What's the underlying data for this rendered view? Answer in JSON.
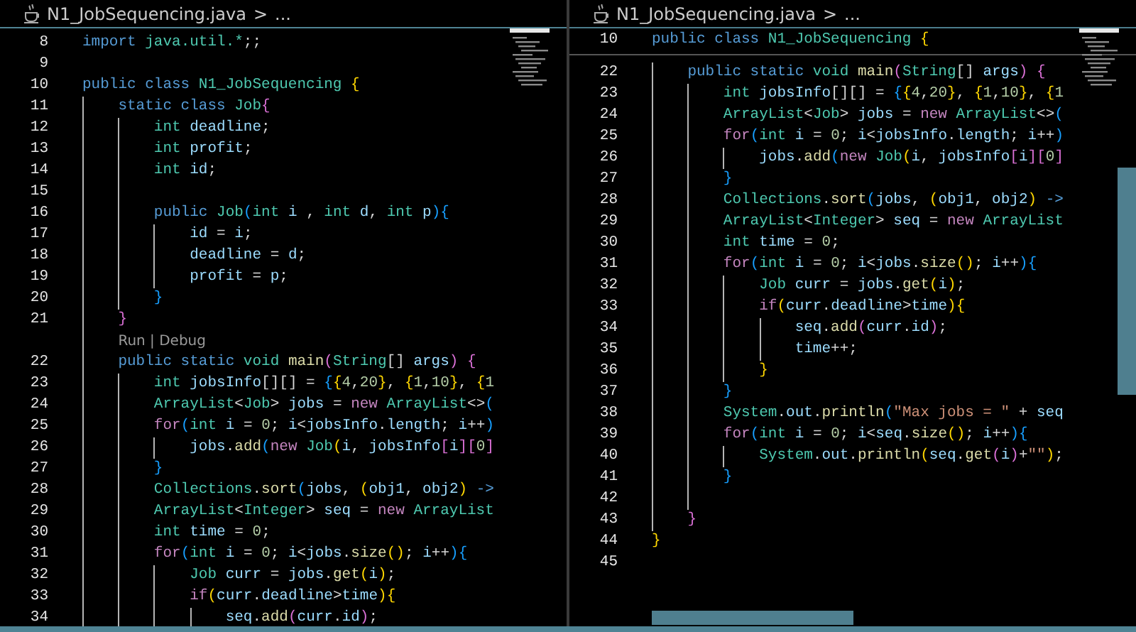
{
  "panes": [
    {
      "breadcrumb": {
        "file": "N1_JobSequencing.java",
        "separator": ">",
        "rest": "..."
      },
      "lines": [
        {
          "kind": "code",
          "number": "8",
          "tokens": [
            {
              "text": "import ",
              "kind": "kw"
            },
            {
              "text": "java.util.*",
              "kind": "ty"
            },
            {
              "text": ";;",
              "kind": "op"
            }
          ]
        },
        {
          "kind": "code",
          "number": "9"
        },
        {
          "kind": "code",
          "number": "10",
          "tokens": [
            {
              "text": "public class ",
              "kind": "kw"
            },
            {
              "text": "N1_JobSequencing ",
              "kind": "ty"
            },
            {
              "text": "{",
              "kind": "b1"
            }
          ]
        },
        {
          "kind": "code",
          "number": "11",
          "tokens": [
            {
              "text": "    static class ",
              "kind": "kw"
            },
            {
              "text": "Job",
              "kind": "ty"
            },
            {
              "text": "{",
              "kind": "b2"
            }
          ]
        },
        {
          "kind": "code",
          "number": "12",
          "tokens": [
            {
              "text": "        int ",
              "kind": "ty"
            },
            {
              "text": "deadline",
              "kind": "var"
            },
            {
              "text": ";",
              "kind": "op"
            }
          ]
        },
        {
          "kind": "code",
          "number": "13",
          "tokens": [
            {
              "text": "        int ",
              "kind": "ty"
            },
            {
              "text": "profit",
              "kind": "var"
            },
            {
              "text": ";",
              "kind": "op"
            }
          ]
        },
        {
          "kind": "code",
          "number": "14",
          "tokens": [
            {
              "text": "        int ",
              "kind": "ty"
            },
            {
              "text": "id",
              "kind": "var"
            },
            {
              "text": ";",
              "kind": "op"
            }
          ]
        },
        {
          "kind": "code",
          "number": "15"
        },
        {
          "kind": "code",
          "number": "16",
          "tokens": [
            {
              "text": "        public ",
              "kind": "kw"
            },
            {
              "text": "Job",
              "kind": "ty"
            },
            {
              "text": "(",
              "kind": "b3"
            },
            {
              "text": "int ",
              "kind": "ty"
            },
            {
              "text": "i",
              "kind": "var"
            },
            {
              "text": " , ",
              "kind": "op"
            },
            {
              "text": "int ",
              "kind": "ty"
            },
            {
              "text": "d",
              "kind": "var"
            },
            {
              "text": ", ",
              "kind": "op"
            },
            {
              "text": "int ",
              "kind": "ty"
            },
            {
              "text": "p",
              "kind": "var"
            },
            {
              "text": ")",
              "kind": "b3"
            },
            {
              "text": "{",
              "kind": "b3"
            }
          ]
        },
        {
          "kind": "code",
          "number": "17",
          "tokens": [
            {
              "text": "            id",
              "kind": "var"
            },
            {
              "text": " = ",
              "kind": "op"
            },
            {
              "text": "i",
              "kind": "var"
            },
            {
              "text": ";",
              "kind": "op"
            }
          ]
        },
        {
          "kind": "code",
          "number": "18",
          "tokens": [
            {
              "text": "            deadline",
              "kind": "var"
            },
            {
              "text": " = ",
              "kind": "op"
            },
            {
              "text": "d",
              "kind": "var"
            },
            {
              "text": ";",
              "kind": "op"
            }
          ]
        },
        {
          "kind": "code",
          "number": "19",
          "tokens": [
            {
              "text": "            profit",
              "kind": "var"
            },
            {
              "text": " = ",
              "kind": "op"
            },
            {
              "text": "p",
              "kind": "var"
            },
            {
              "text": ";",
              "kind": "op"
            }
          ]
        },
        {
          "kind": "code",
          "number": "20",
          "tokens": [
            {
              "text": "        }",
              "kind": "b3"
            }
          ]
        },
        {
          "kind": "code",
          "number": "21",
          "tokens": [
            {
              "text": "    }",
              "kind": "b2"
            }
          ]
        },
        {
          "kind": "codelens",
          "text": "Run | Debug"
        },
        {
          "kind": "code",
          "number": "22",
          "tokens": [
            {
              "text": "    public static ",
              "kind": "kw"
            },
            {
              "text": "void ",
              "kind": "ty"
            },
            {
              "text": "main",
              "kind": "fn"
            },
            {
              "text": "(",
              "kind": "b2"
            },
            {
              "text": "String",
              "kind": "ty"
            },
            {
              "text": "[] ",
              "kind": "op"
            },
            {
              "text": "args",
              "kind": "var"
            },
            {
              "text": ")",
              "kind": "b2"
            },
            {
              "text": " {",
              "kind": "b2"
            }
          ]
        },
        {
          "kind": "code",
          "number": "23",
          "tokens": [
            {
              "text": "        int ",
              "kind": "ty"
            },
            {
              "text": "jobsInfo",
              "kind": "var"
            },
            {
              "text": "[][] = ",
              "kind": "op"
            },
            {
              "text": "{",
              "kind": "b3"
            },
            {
              "text": "{",
              "kind": "b1"
            },
            {
              "text": "4",
              "kind": "num"
            },
            {
              "text": ",",
              "kind": "op"
            },
            {
              "text": "20",
              "kind": "num"
            },
            {
              "text": "}",
              "kind": "b1"
            },
            {
              "text": ", ",
              "kind": "op"
            },
            {
              "text": "{",
              "kind": "b1"
            },
            {
              "text": "1",
              "kind": "num"
            },
            {
              "text": ",",
              "kind": "op"
            },
            {
              "text": "10",
              "kind": "num"
            },
            {
              "text": "}",
              "kind": "b1"
            },
            {
              "text": ", ",
              "kind": "op"
            },
            {
              "text": "{",
              "kind": "b1"
            },
            {
              "text": "1",
              "kind": "num"
            }
          ]
        },
        {
          "kind": "code",
          "number": "24",
          "tokens": [
            {
              "text": "        ArrayList",
              "kind": "ty"
            },
            {
              "text": "<",
              "kind": "op"
            },
            {
              "text": "Job",
              "kind": "ty"
            },
            {
              "text": "> ",
              "kind": "op"
            },
            {
              "text": "jobs",
              "kind": "var"
            },
            {
              "text": " = ",
              "kind": "op"
            },
            {
              "text": "new ",
              "kind": "ctl"
            },
            {
              "text": "ArrayList",
              "kind": "ty"
            },
            {
              "text": "<>",
              "kind": "op"
            },
            {
              "text": "(",
              "kind": "b3"
            }
          ]
        },
        {
          "kind": "code",
          "number": "25",
          "tokens": [
            {
              "text": "        for",
              "kind": "ctl"
            },
            {
              "text": "(",
              "kind": "b3"
            },
            {
              "text": "int ",
              "kind": "ty"
            },
            {
              "text": "i",
              "kind": "var"
            },
            {
              "text": " = ",
              "kind": "op"
            },
            {
              "text": "0",
              "kind": "num"
            },
            {
              "text": "; ",
              "kind": "op"
            },
            {
              "text": "i",
              "kind": "var"
            },
            {
              "text": "<",
              "kind": "op"
            },
            {
              "text": "jobsInfo",
              "kind": "var"
            },
            {
              "text": ".",
              "kind": "op"
            },
            {
              "text": "length",
              "kind": "var"
            },
            {
              "text": "; ",
              "kind": "op"
            },
            {
              "text": "i",
              "kind": "var"
            },
            {
              "text": "++",
              "kind": "op"
            },
            {
              "text": ")",
              "kind": "b3"
            }
          ]
        },
        {
          "kind": "code",
          "number": "26",
          "tokens": [
            {
              "text": "            jobs",
              "kind": "var"
            },
            {
              "text": ".",
              "kind": "op"
            },
            {
              "text": "add",
              "kind": "fn"
            },
            {
              "text": "(",
              "kind": "b3"
            },
            {
              "text": "new ",
              "kind": "ctl"
            },
            {
              "text": "Job",
              "kind": "ty"
            },
            {
              "text": "(",
              "kind": "b1"
            },
            {
              "text": "i",
              "kind": "var"
            },
            {
              "text": ", ",
              "kind": "op"
            },
            {
              "text": "jobsInfo",
              "kind": "var"
            },
            {
              "text": "[",
              "kind": "b2"
            },
            {
              "text": "i",
              "kind": "var"
            },
            {
              "text": "]",
              "kind": "b2"
            },
            {
              "text": "[",
              "kind": "b2"
            },
            {
              "text": "0",
              "kind": "num"
            },
            {
              "text": "]",
              "kind": "b2"
            }
          ]
        },
        {
          "kind": "code",
          "number": "27",
          "tokens": [
            {
              "text": "        }",
              "kind": "b3"
            }
          ]
        },
        {
          "kind": "code",
          "number": "28",
          "tokens": [
            {
              "text": "        Collections",
              "kind": "ty"
            },
            {
              "text": ".",
              "kind": "op"
            },
            {
              "text": "sort",
              "kind": "fn"
            },
            {
              "text": "(",
              "kind": "b3"
            },
            {
              "text": "jobs",
              "kind": "var"
            },
            {
              "text": ", ",
              "kind": "op"
            },
            {
              "text": "(",
              "kind": "b1"
            },
            {
              "text": "obj1",
              "kind": "var"
            },
            {
              "text": ", ",
              "kind": "op"
            },
            {
              "text": "obj2",
              "kind": "var"
            },
            {
              "text": ")",
              "kind": "b1"
            },
            {
              "text": " ->",
              "kind": "kw"
            }
          ]
        },
        {
          "kind": "code",
          "number": "29",
          "tokens": [
            {
              "text": "        ArrayList",
              "kind": "ty"
            },
            {
              "text": "<",
              "kind": "op"
            },
            {
              "text": "Integer",
              "kind": "ty"
            },
            {
              "text": "> ",
              "kind": "op"
            },
            {
              "text": "seq",
              "kind": "var"
            },
            {
              "text": " = ",
              "kind": "op"
            },
            {
              "text": "new ",
              "kind": "ctl"
            },
            {
              "text": "ArrayList",
              "kind": "ty"
            }
          ]
        },
        {
          "kind": "code",
          "number": "30",
          "tokens": [
            {
              "text": "        int ",
              "kind": "ty"
            },
            {
              "text": "time",
              "kind": "var"
            },
            {
              "text": " = ",
              "kind": "op"
            },
            {
              "text": "0",
              "kind": "num"
            },
            {
              "text": ";",
              "kind": "op"
            }
          ]
        },
        {
          "kind": "code",
          "number": "31",
          "tokens": [
            {
              "text": "        for",
              "kind": "ctl"
            },
            {
              "text": "(",
              "kind": "b3"
            },
            {
              "text": "int ",
              "kind": "ty"
            },
            {
              "text": "i",
              "kind": "var"
            },
            {
              "text": " = ",
              "kind": "op"
            },
            {
              "text": "0",
              "kind": "num"
            },
            {
              "text": "; ",
              "kind": "op"
            },
            {
              "text": "i",
              "kind": "var"
            },
            {
              "text": "<",
              "kind": "op"
            },
            {
              "text": "jobs",
              "kind": "var"
            },
            {
              "text": ".",
              "kind": "op"
            },
            {
              "text": "size",
              "kind": "fn"
            },
            {
              "text": "()",
              "kind": "b1"
            },
            {
              "text": "; ",
              "kind": "op"
            },
            {
              "text": "i",
              "kind": "var"
            },
            {
              "text": "++",
              "kind": "op"
            },
            {
              "text": ")",
              "kind": "b3"
            },
            {
              "text": "{",
              "kind": "b3"
            }
          ]
        },
        {
          "kind": "code",
          "number": "32",
          "tokens": [
            {
              "text": "            Job ",
              "kind": "ty"
            },
            {
              "text": "curr",
              "kind": "var"
            },
            {
              "text": " = ",
              "kind": "op"
            },
            {
              "text": "jobs",
              "kind": "var"
            },
            {
              "text": ".",
              "kind": "op"
            },
            {
              "text": "get",
              "kind": "fn"
            },
            {
              "text": "(",
              "kind": "b1"
            },
            {
              "text": "i",
              "kind": "var"
            },
            {
              "text": ")",
              "kind": "b1"
            },
            {
              "text": ";",
              "kind": "op"
            }
          ]
        },
        {
          "kind": "code",
          "number": "33",
          "tokens": [
            {
              "text": "            if",
              "kind": "ctl"
            },
            {
              "text": "(",
              "kind": "b1"
            },
            {
              "text": "curr",
              "kind": "var"
            },
            {
              "text": ".",
              "kind": "op"
            },
            {
              "text": "deadline",
              "kind": "var"
            },
            {
              "text": ">",
              "kind": "op"
            },
            {
              "text": "time",
              "kind": "var"
            },
            {
              "text": ")",
              "kind": "b1"
            },
            {
              "text": "{",
              "kind": "b1"
            }
          ]
        },
        {
          "kind": "code",
          "number": "34",
          "tokens": [
            {
              "text": "                seq",
              "kind": "var"
            },
            {
              "text": ".",
              "kind": "op"
            },
            {
              "text": "add",
              "kind": "fn"
            },
            {
              "text": "(",
              "kind": "b2"
            },
            {
              "text": "curr",
              "kind": "var"
            },
            {
              "text": ".",
              "kind": "op"
            },
            {
              "text": "id",
              "kind": "var"
            },
            {
              "text": ")",
              "kind": "b2"
            },
            {
              "text": ";",
              "kind": "op"
            }
          ]
        }
      ]
    },
    {
      "breadcrumb": {
        "file": "N1_JobSequencing.java",
        "separator": ">",
        "rest": "..."
      },
      "sticky": {
        "kind": "code",
        "number": "10",
        "tokens": [
          {
            "text": "public class ",
            "kind": "kw"
          },
          {
            "text": "N1_JobSequencing ",
            "kind": "ty"
          },
          {
            "text": "{",
            "kind": "b1"
          }
        ]
      },
      "scrollbars": true,
      "lines": [
        {
          "kind": "code",
          "number": "22",
          "tokens": [
            {
              "text": "    public static ",
              "kind": "kw"
            },
            {
              "text": "void ",
              "kind": "ty"
            },
            {
              "text": "main",
              "kind": "fn"
            },
            {
              "text": "(",
              "kind": "b2"
            },
            {
              "text": "String",
              "kind": "ty"
            },
            {
              "text": "[] ",
              "kind": "op"
            },
            {
              "text": "args",
              "kind": "var"
            },
            {
              "text": ")",
              "kind": "b2"
            },
            {
              "text": " {",
              "kind": "b2"
            }
          ]
        },
        {
          "kind": "code",
          "number": "23",
          "tokens": [
            {
              "text": "        int ",
              "kind": "ty"
            },
            {
              "text": "jobsInfo",
              "kind": "var"
            },
            {
              "text": "[][] = ",
              "kind": "op"
            },
            {
              "text": "{",
              "kind": "b3"
            },
            {
              "text": "{",
              "kind": "b1"
            },
            {
              "text": "4",
              "kind": "num"
            },
            {
              "text": ",",
              "kind": "op"
            },
            {
              "text": "20",
              "kind": "num"
            },
            {
              "text": "}",
              "kind": "b1"
            },
            {
              "text": ", ",
              "kind": "op"
            },
            {
              "text": "{",
              "kind": "b1"
            },
            {
              "text": "1",
              "kind": "num"
            },
            {
              "text": ",",
              "kind": "op"
            },
            {
              "text": "10",
              "kind": "num"
            },
            {
              "text": "}",
              "kind": "b1"
            },
            {
              "text": ", ",
              "kind": "op"
            },
            {
              "text": "{",
              "kind": "b1"
            },
            {
              "text": "1",
              "kind": "num"
            }
          ]
        },
        {
          "kind": "code",
          "number": "24",
          "tokens": [
            {
              "text": "        ArrayList",
              "kind": "ty"
            },
            {
              "text": "<",
              "kind": "op"
            },
            {
              "text": "Job",
              "kind": "ty"
            },
            {
              "text": "> ",
              "kind": "op"
            },
            {
              "text": "jobs",
              "kind": "var"
            },
            {
              "text": " = ",
              "kind": "op"
            },
            {
              "text": "new ",
              "kind": "ctl"
            },
            {
              "text": "ArrayList",
              "kind": "ty"
            },
            {
              "text": "<>",
              "kind": "op"
            },
            {
              "text": "(",
              "kind": "b3"
            }
          ]
        },
        {
          "kind": "code",
          "number": "25",
          "tokens": [
            {
              "text": "        for",
              "kind": "ctl"
            },
            {
              "text": "(",
              "kind": "b3"
            },
            {
              "text": "int ",
              "kind": "ty"
            },
            {
              "text": "i",
              "kind": "var"
            },
            {
              "text": " = ",
              "kind": "op"
            },
            {
              "text": "0",
              "kind": "num"
            },
            {
              "text": "; ",
              "kind": "op"
            },
            {
              "text": "i",
              "kind": "var"
            },
            {
              "text": "<",
              "kind": "op"
            },
            {
              "text": "jobsInfo",
              "kind": "var"
            },
            {
              "text": ".",
              "kind": "op"
            },
            {
              "text": "length",
              "kind": "var"
            },
            {
              "text": "; ",
              "kind": "op"
            },
            {
              "text": "i",
              "kind": "var"
            },
            {
              "text": "++",
              "kind": "op"
            },
            {
              "text": ")",
              "kind": "b3"
            }
          ]
        },
        {
          "kind": "code",
          "number": "26",
          "tokens": [
            {
              "text": "            jobs",
              "kind": "var"
            },
            {
              "text": ".",
              "kind": "op"
            },
            {
              "text": "add",
              "kind": "fn"
            },
            {
              "text": "(",
              "kind": "b3"
            },
            {
              "text": "new ",
              "kind": "ctl"
            },
            {
              "text": "Job",
              "kind": "ty"
            },
            {
              "text": "(",
              "kind": "b1"
            },
            {
              "text": "i",
              "kind": "var"
            },
            {
              "text": ", ",
              "kind": "op"
            },
            {
              "text": "jobsInfo",
              "kind": "var"
            },
            {
              "text": "[",
              "kind": "b2"
            },
            {
              "text": "i",
              "kind": "var"
            },
            {
              "text": "]",
              "kind": "b2"
            },
            {
              "text": "[",
              "kind": "b2"
            },
            {
              "text": "0",
              "kind": "num"
            },
            {
              "text": "]",
              "kind": "b2"
            }
          ]
        },
        {
          "kind": "code",
          "number": "27",
          "tokens": [
            {
              "text": "        }",
              "kind": "b3"
            }
          ]
        },
        {
          "kind": "code",
          "number": "28",
          "tokens": [
            {
              "text": "        Collections",
              "kind": "ty"
            },
            {
              "text": ".",
              "kind": "op"
            },
            {
              "text": "sort",
              "kind": "fn"
            },
            {
              "text": "(",
              "kind": "b3"
            },
            {
              "text": "jobs",
              "kind": "var"
            },
            {
              "text": ", ",
              "kind": "op"
            },
            {
              "text": "(",
              "kind": "b1"
            },
            {
              "text": "obj1",
              "kind": "var"
            },
            {
              "text": ", ",
              "kind": "op"
            },
            {
              "text": "obj2",
              "kind": "var"
            },
            {
              "text": ")",
              "kind": "b1"
            },
            {
              "text": " ->",
              "kind": "kw"
            }
          ]
        },
        {
          "kind": "code",
          "number": "29",
          "tokens": [
            {
              "text": "        ArrayList",
              "kind": "ty"
            },
            {
              "text": "<",
              "kind": "op"
            },
            {
              "text": "Integer",
              "kind": "ty"
            },
            {
              "text": "> ",
              "kind": "op"
            },
            {
              "text": "seq",
              "kind": "var"
            },
            {
              "text": " = ",
              "kind": "op"
            },
            {
              "text": "new ",
              "kind": "ctl"
            },
            {
              "text": "ArrayList",
              "kind": "ty"
            }
          ]
        },
        {
          "kind": "code",
          "number": "30",
          "tokens": [
            {
              "text": "        int ",
              "kind": "ty"
            },
            {
              "text": "time",
              "kind": "var"
            },
            {
              "text": " = ",
              "kind": "op"
            },
            {
              "text": "0",
              "kind": "num"
            },
            {
              "text": ";",
              "kind": "op"
            }
          ]
        },
        {
          "kind": "code",
          "number": "31",
          "tokens": [
            {
              "text": "        for",
              "kind": "ctl"
            },
            {
              "text": "(",
              "kind": "b3"
            },
            {
              "text": "int ",
              "kind": "ty"
            },
            {
              "text": "i",
              "kind": "var"
            },
            {
              "text": " = ",
              "kind": "op"
            },
            {
              "text": "0",
              "kind": "num"
            },
            {
              "text": "; ",
              "kind": "op"
            },
            {
              "text": "i",
              "kind": "var"
            },
            {
              "text": "<",
              "kind": "op"
            },
            {
              "text": "jobs",
              "kind": "var"
            },
            {
              "text": ".",
              "kind": "op"
            },
            {
              "text": "size",
              "kind": "fn"
            },
            {
              "text": "()",
              "kind": "b1"
            },
            {
              "text": "; ",
              "kind": "op"
            },
            {
              "text": "i",
              "kind": "var"
            },
            {
              "text": "++",
              "kind": "op"
            },
            {
              "text": ")",
              "kind": "b3"
            },
            {
              "text": "{",
              "kind": "b3"
            }
          ]
        },
        {
          "kind": "code",
          "number": "32",
          "tokens": [
            {
              "text": "            Job ",
              "kind": "ty"
            },
            {
              "text": "curr",
              "kind": "var"
            },
            {
              "text": " = ",
              "kind": "op"
            },
            {
              "text": "jobs",
              "kind": "var"
            },
            {
              "text": ".",
              "kind": "op"
            },
            {
              "text": "get",
              "kind": "fn"
            },
            {
              "text": "(",
              "kind": "b1"
            },
            {
              "text": "i",
              "kind": "var"
            },
            {
              "text": ")",
              "kind": "b1"
            },
            {
              "text": ";",
              "kind": "op"
            }
          ]
        },
        {
          "kind": "code",
          "number": "33",
          "tokens": [
            {
              "text": "            if",
              "kind": "ctl"
            },
            {
              "text": "(",
              "kind": "b1"
            },
            {
              "text": "curr",
              "kind": "var"
            },
            {
              "text": ".",
              "kind": "op"
            },
            {
              "text": "deadline",
              "kind": "var"
            },
            {
              "text": ">",
              "kind": "op"
            },
            {
              "text": "time",
              "kind": "var"
            },
            {
              "text": ")",
              "kind": "b1"
            },
            {
              "text": "{",
              "kind": "b1"
            }
          ]
        },
        {
          "kind": "code",
          "number": "34",
          "tokens": [
            {
              "text": "                seq",
              "kind": "var"
            },
            {
              "text": ".",
              "kind": "op"
            },
            {
              "text": "add",
              "kind": "fn"
            },
            {
              "text": "(",
              "kind": "b2"
            },
            {
              "text": "curr",
              "kind": "var"
            },
            {
              "text": ".",
              "kind": "op"
            },
            {
              "text": "id",
              "kind": "var"
            },
            {
              "text": ")",
              "kind": "b2"
            },
            {
              "text": ";",
              "kind": "op"
            }
          ]
        },
        {
          "kind": "code",
          "number": "35",
          "tokens": [
            {
              "text": "                time",
              "kind": "var"
            },
            {
              "text": "++;",
              "kind": "op"
            }
          ]
        },
        {
          "kind": "code",
          "number": "36",
          "tokens": [
            {
              "text": "            }",
              "kind": "b1"
            }
          ]
        },
        {
          "kind": "code",
          "number": "37",
          "tokens": [
            {
              "text": "        }",
              "kind": "b3"
            }
          ]
        },
        {
          "kind": "code",
          "number": "38",
          "tokens": [
            {
              "text": "        System",
              "kind": "ty"
            },
            {
              "text": ".",
              "kind": "op"
            },
            {
              "text": "out",
              "kind": "var"
            },
            {
              "text": ".",
              "kind": "op"
            },
            {
              "text": "println",
              "kind": "fn"
            },
            {
              "text": "(",
              "kind": "b3"
            },
            {
              "text": "\"Max jobs = \"",
              "kind": "str"
            },
            {
              "text": " + ",
              "kind": "op"
            },
            {
              "text": "seq",
              "kind": "var"
            }
          ]
        },
        {
          "kind": "code",
          "number": "39",
          "tokens": [
            {
              "text": "        for",
              "kind": "ctl"
            },
            {
              "text": "(",
              "kind": "b3"
            },
            {
              "text": "int ",
              "kind": "ty"
            },
            {
              "text": "i",
              "kind": "var"
            },
            {
              "text": " = ",
              "kind": "op"
            },
            {
              "text": "0",
              "kind": "num"
            },
            {
              "text": "; ",
              "kind": "op"
            },
            {
              "text": "i",
              "kind": "var"
            },
            {
              "text": "<",
              "kind": "op"
            },
            {
              "text": "seq",
              "kind": "var"
            },
            {
              "text": ".",
              "kind": "op"
            },
            {
              "text": "size",
              "kind": "fn"
            },
            {
              "text": "()",
              "kind": "b1"
            },
            {
              "text": "; ",
              "kind": "op"
            },
            {
              "text": "i",
              "kind": "var"
            },
            {
              "text": "++",
              "kind": "op"
            },
            {
              "text": ")",
              "kind": "b3"
            },
            {
              "text": "{",
              "kind": "b3"
            }
          ]
        },
        {
          "kind": "code",
          "number": "40",
          "tokens": [
            {
              "text": "            System",
              "kind": "ty"
            },
            {
              "text": ".",
              "kind": "op"
            },
            {
              "text": "out",
              "kind": "var"
            },
            {
              "text": ".",
              "kind": "op"
            },
            {
              "text": "println",
              "kind": "fn"
            },
            {
              "text": "(",
              "kind": "b1"
            },
            {
              "text": "seq",
              "kind": "var"
            },
            {
              "text": ".",
              "kind": "op"
            },
            {
              "text": "get",
              "kind": "fn"
            },
            {
              "text": "(",
              "kind": "b2"
            },
            {
              "text": "i",
              "kind": "var"
            },
            {
              "text": ")",
              "kind": "b2"
            },
            {
              "text": "+",
              "kind": "op"
            },
            {
              "text": "\"\"",
              "kind": "str"
            },
            {
              "text": ")",
              "kind": "b1"
            },
            {
              "text": ";",
              "kind": "op"
            }
          ]
        },
        {
          "kind": "code",
          "number": "41",
          "tokens": [
            {
              "text": "        }",
              "kind": "b3"
            }
          ]
        },
        {
          "kind": "code",
          "number": "42"
        },
        {
          "kind": "code",
          "number": "43",
          "tokens": [
            {
              "text": "    }",
              "kind": "b2"
            }
          ]
        },
        {
          "kind": "code",
          "number": "44",
          "tokens": [
            {
              "text": "}",
              "kind": "b1"
            }
          ]
        },
        {
          "kind": "code",
          "number": "45"
        }
      ]
    }
  ]
}
